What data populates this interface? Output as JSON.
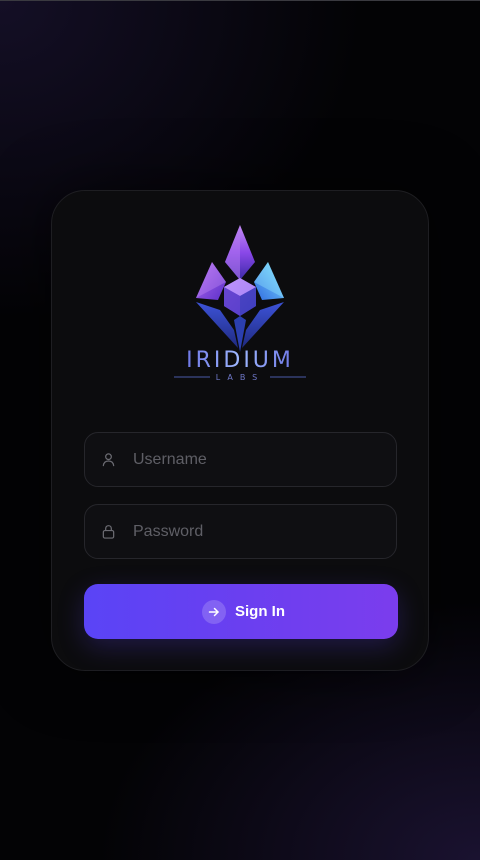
{
  "brand": {
    "name": "IRIDIUM",
    "sub": "LABS"
  },
  "form": {
    "username": {
      "placeholder": "Username",
      "icon": "user-icon"
    },
    "password": {
      "placeholder": "Password",
      "icon": "lock-icon"
    },
    "submit": {
      "label": "Sign In",
      "icon": "arrow-right-icon"
    }
  },
  "colors": {
    "accent_start": "#5a44f6",
    "accent_end": "#7b3ded",
    "background": "#030305",
    "card": "#0c0c0e"
  }
}
